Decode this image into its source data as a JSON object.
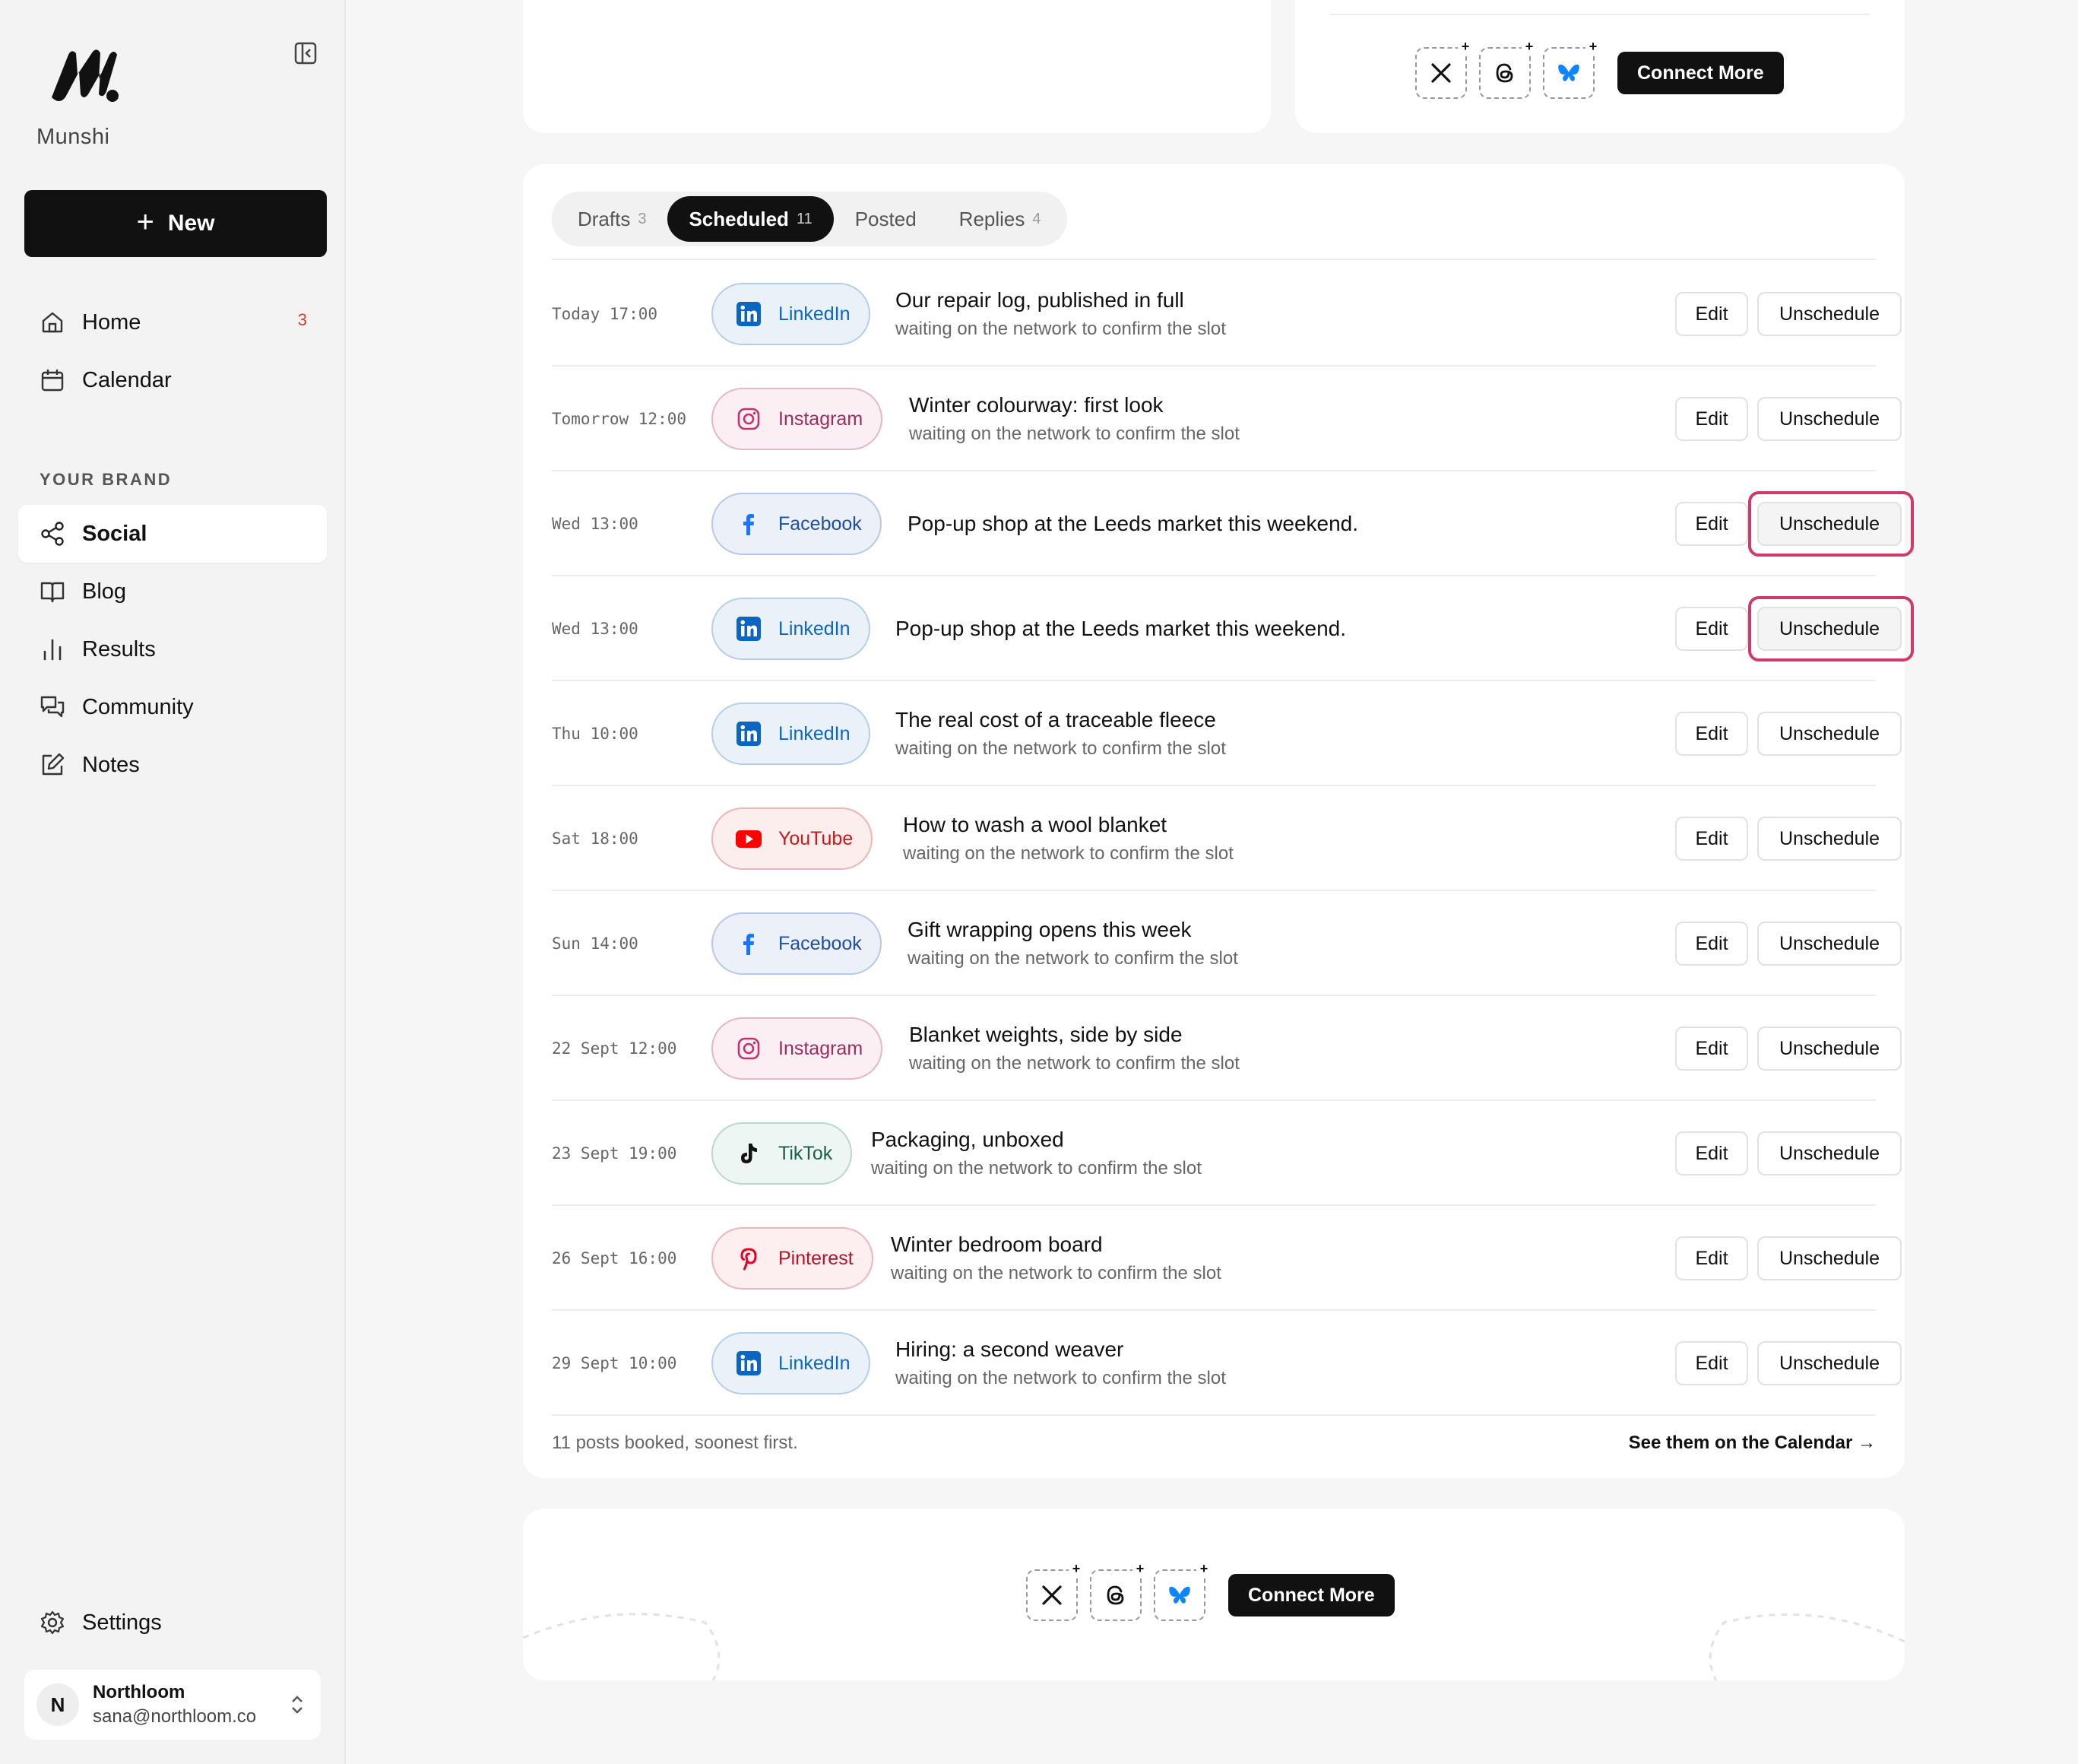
{
  "sidebar": {
    "brand": "Munshi",
    "new_label": "New",
    "nav": [
      {
        "label": "Home",
        "badge": "3"
      },
      {
        "label": "Calendar"
      }
    ],
    "section_label": "YOUR BRAND",
    "brand_nav": [
      {
        "label": "Social",
        "active": true
      },
      {
        "label": "Blog"
      },
      {
        "label": "Results"
      },
      {
        "label": "Community"
      },
      {
        "label": "Notes"
      }
    ],
    "settings_label": "Settings",
    "user": {
      "initial": "N",
      "name": "Northloom",
      "email": "sana@northloom.co"
    }
  },
  "connect": {
    "label": "Connect More",
    "networks": [
      "x-icon",
      "threads-icon",
      "bluesky-icon"
    ]
  },
  "tabs": [
    {
      "label": "Drafts",
      "count": "3"
    },
    {
      "label": "Scheduled",
      "count": "11",
      "active": true
    },
    {
      "label": "Posted",
      "count": ""
    },
    {
      "label": "Replies",
      "count": "4"
    }
  ],
  "posts": [
    {
      "time": "Today 17:00",
      "network": "LinkedIn",
      "title": "Our repair log, published in full",
      "sub": "waiting on the network to confirm the slot"
    },
    {
      "time": "Tomorrow 12:00",
      "network": "Instagram",
      "title": "Winter colourway: first look",
      "sub": "waiting on the network to confirm the slot"
    },
    {
      "time": "Wed 13:00",
      "network": "Facebook",
      "title": "Pop-up shop at the Leeds market this weekend.",
      "sub": "",
      "highlighted": true
    },
    {
      "time": "Wed 13:00",
      "network": "LinkedIn",
      "title": "Pop-up shop at the Leeds market this weekend.",
      "sub": "",
      "highlighted": true
    },
    {
      "time": "Thu 10:00",
      "network": "LinkedIn",
      "title": "The real cost of a traceable fleece",
      "sub": "waiting on the network to confirm the slot"
    },
    {
      "time": "Sat 18:00",
      "network": "YouTube",
      "title": "How to wash a wool blanket",
      "sub": "waiting on the network to confirm the slot"
    },
    {
      "time": "Sun 14:00",
      "network": "Facebook",
      "title": "Gift wrapping opens this week",
      "sub": "waiting on the network to confirm the slot"
    },
    {
      "time": "22 Sept 12:00",
      "network": "Instagram",
      "title": "Blanket weights, side by side",
      "sub": "waiting on the network to confirm the slot"
    },
    {
      "time": "23 Sept 19:00",
      "network": "TikTok",
      "title": "Packaging, unboxed",
      "sub": "waiting on the network to confirm the slot"
    },
    {
      "time": "26 Sept 16:00",
      "network": "Pinterest",
      "title": "Winter bedroom board",
      "sub": "waiting on the network to confirm the slot"
    },
    {
      "time": "29 Sept 10:00",
      "network": "LinkedIn",
      "title": "Hiring: a second weaver",
      "sub": "waiting on the network to confirm the slot"
    }
  ],
  "actions": {
    "edit": "Edit",
    "unschedule": "Unschedule"
  },
  "footer": {
    "summary": "11 posts booked, soonest first.",
    "link": "See them on the Calendar →"
  },
  "colors": {
    "accent": "#111111",
    "focus_ring": "#cf3a6a",
    "badge": "#d43a2f"
  }
}
